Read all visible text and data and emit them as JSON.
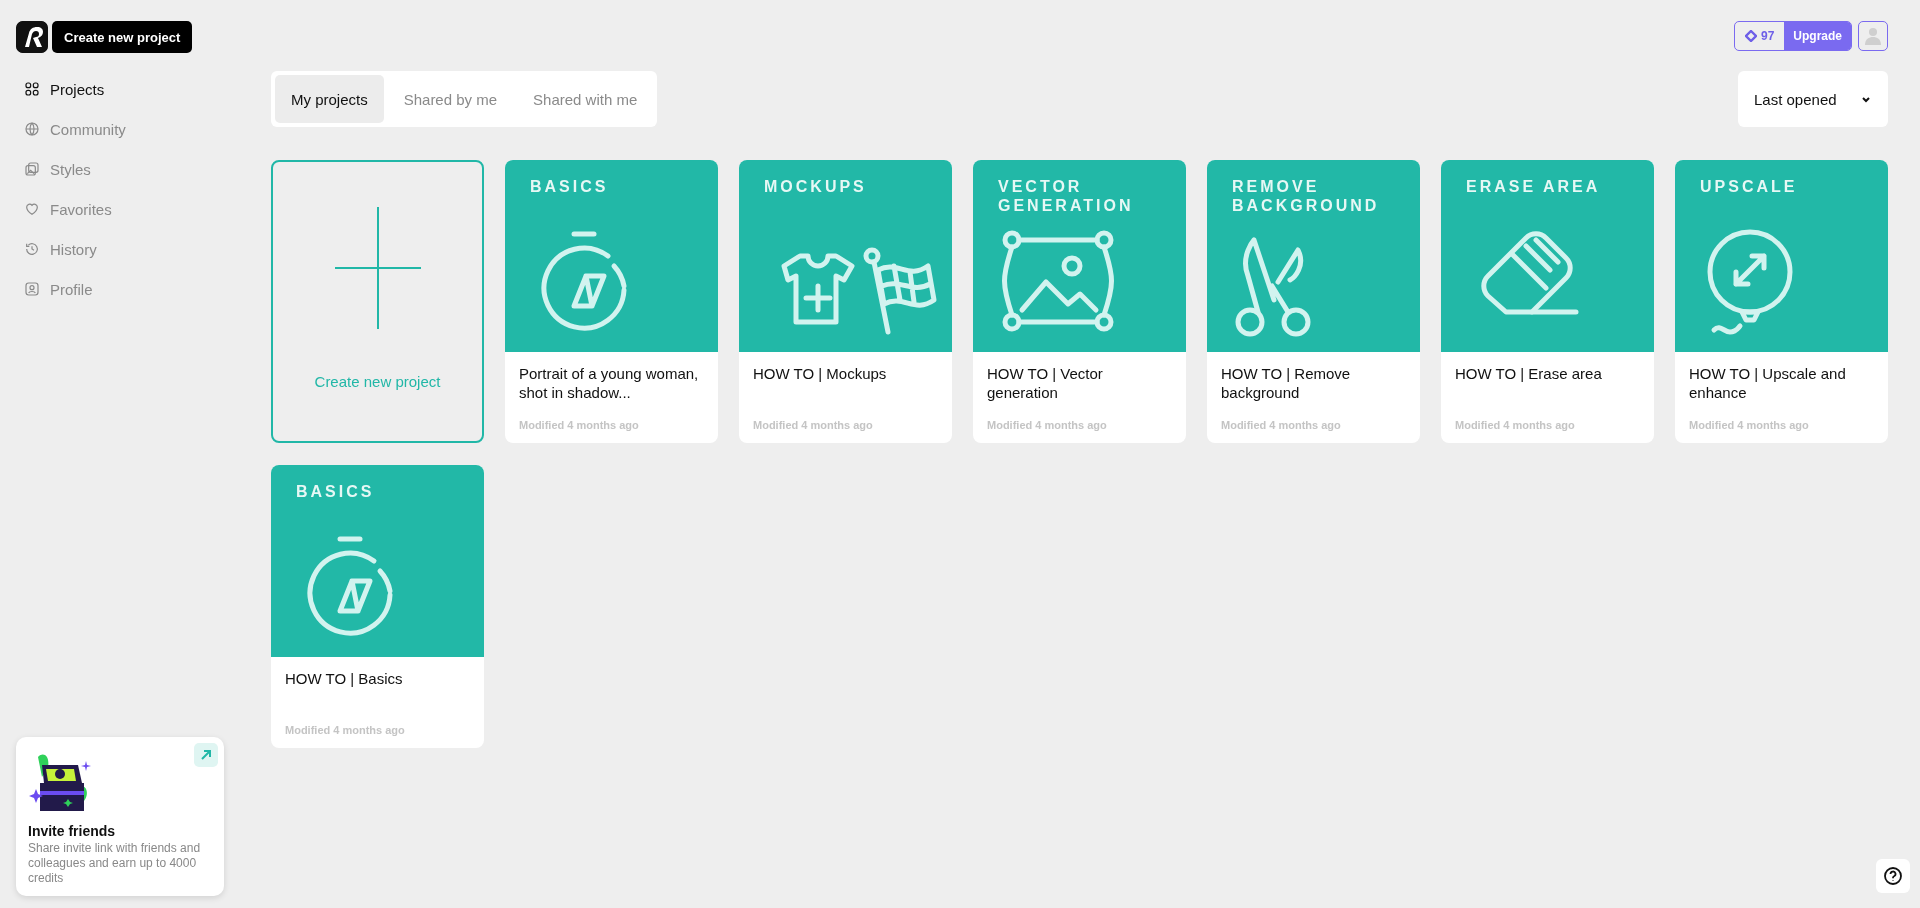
{
  "sidebar": {
    "create_button": "Create new project",
    "items": [
      {
        "label": "Projects",
        "kind": "grid",
        "selected": true
      },
      {
        "label": "Community",
        "kind": "globe",
        "selected": false
      },
      {
        "label": "Styles",
        "kind": "images",
        "selected": false
      },
      {
        "label": "Favorites",
        "kind": "heart",
        "selected": false
      },
      {
        "label": "History",
        "kind": "history",
        "selected": false
      },
      {
        "label": "Profile",
        "kind": "profile",
        "selected": false
      }
    ],
    "invite": {
      "title": "Invite friends",
      "text": "Share invite link with friends and colleagues and earn up to 4000 credits"
    }
  },
  "header": {
    "credits": "97",
    "upgrade": "Upgrade"
  },
  "tabs": [
    {
      "label": "My projects",
      "selected": true
    },
    {
      "label": "Shared by me",
      "selected": false
    },
    {
      "label": "Shared with me",
      "selected": false
    }
  ],
  "sort": {
    "value": "Last opened"
  },
  "create_card": {
    "label": "Create new project"
  },
  "projects": [
    {
      "banner": "BASICS",
      "kind": "stopwatch",
      "title": "Portrait of a young woman, shot in shadow...",
      "modified": "Modified 4 months ago"
    },
    {
      "banner": "MOCKUPS",
      "kind": "mockup",
      "title": "HOW TO | Mockups",
      "modified": "Modified 4 months ago"
    },
    {
      "banner": "VECTOR GENERATION",
      "kind": "vector",
      "title": "HOW TO | Vector generation",
      "modified": "Modified 4 months ago"
    },
    {
      "banner": "REMOVE BACKGROUND",
      "kind": "scissors",
      "title": "HOW TO | Remove background",
      "modified": "Modified 4 months ago"
    },
    {
      "banner": "ERASE AREA",
      "kind": "eraser",
      "title": "HOW TO | Erase area",
      "modified": "Modified 4 months ago"
    },
    {
      "banner": "UPSCALE",
      "kind": "balloon",
      "title": "HOW TO | Upscale and enhance",
      "modified": "Modified 4 months ago"
    },
    {
      "banner": "BASICS",
      "kind": "stopwatch",
      "title": "HOW TO | Basics",
      "modified": "Modified 4 months ago"
    }
  ]
}
